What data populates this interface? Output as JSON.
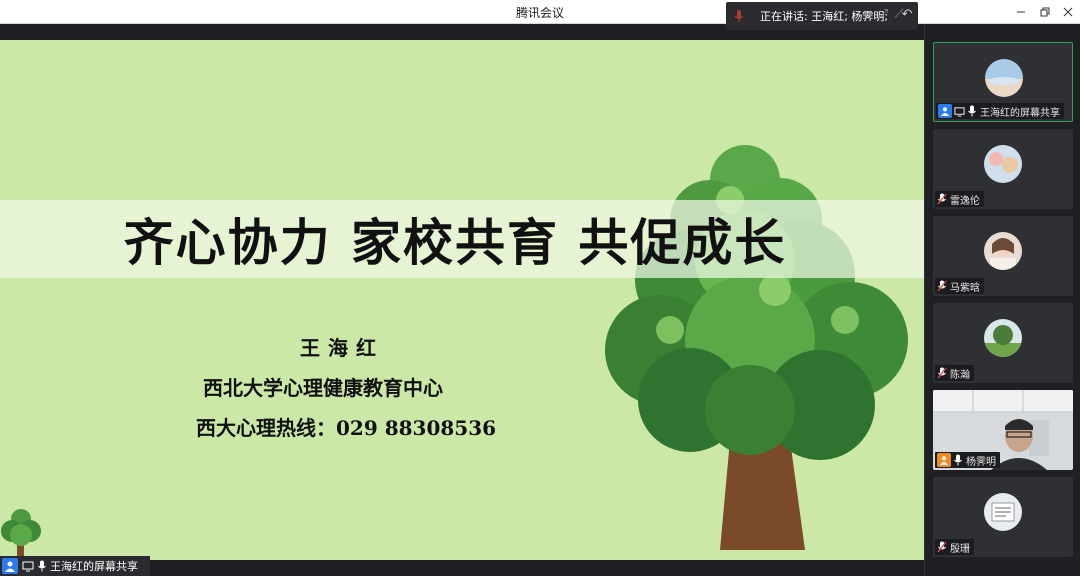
{
  "window": {
    "title": "腾讯会议",
    "speaking_text": "正在讲话: 王海红; 杨霁明;"
  },
  "slide": {
    "title": "齐心协力 家校共育 共促成长",
    "presenter": "王海红",
    "organization": "西北大学心理健康教育中心",
    "hotline": "西大心理热线：029 88308536"
  },
  "share_label": "王海红的屏幕共享",
  "participants": [
    {
      "name": "王海红的屏幕共享",
      "mic": "on",
      "active": true
    },
    {
      "name": "雷逸伦",
      "mic": "muted"
    },
    {
      "name": "马紫晗",
      "mic": "muted"
    },
    {
      "name": "陈瀚",
      "mic": "muted"
    },
    {
      "name": "杨霁明",
      "mic": "on",
      "video": true
    },
    {
      "name": "殷珊",
      "mic": "muted"
    }
  ],
  "colors": {
    "slide_bg": "#cce8a7",
    "active_border": "#3a9d5a",
    "host_badge": "#2b7bf0",
    "user_badge": "#f08a24",
    "muted_red": "#e34a4a"
  }
}
